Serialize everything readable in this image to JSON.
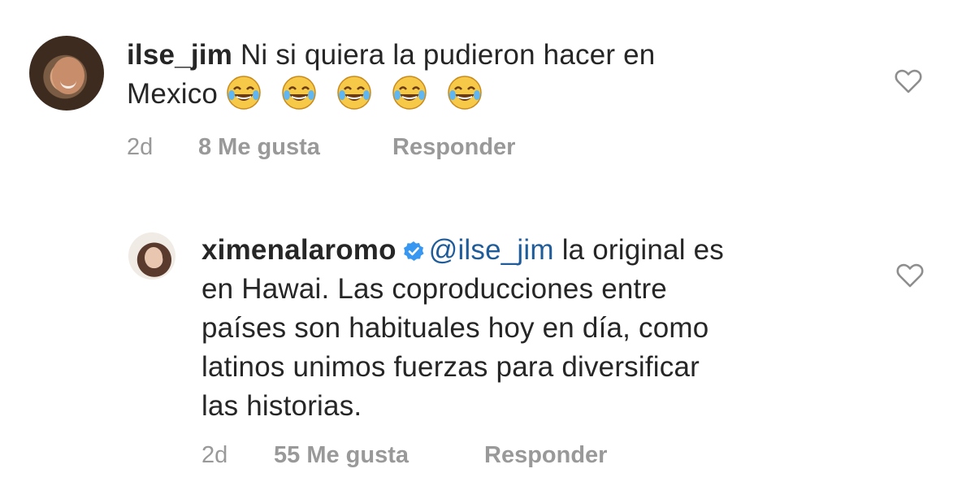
{
  "comments": [
    {
      "username": "ilse_jim",
      "text_line1": "Ni si quiera la pudieron hacer en",
      "text_line2": "Mexico",
      "emojis": [
        "face-with-tears-of-joy",
        "face-with-tears-of-joy",
        "face-with-tears-of-joy",
        "face-with-tears-of-joy",
        "face-with-tears-of-joy"
      ],
      "time": "2d",
      "likes": "8 Me gusta",
      "reply": "Responder",
      "icon": "heart-icon"
    },
    {
      "username": "ximenalaromo",
      "verified": true,
      "mention": "@ilse_jim",
      "text_line1": "la original es",
      "text_line2": "en Hawai. Las coproducciones entre",
      "text_line3": "países son habituales hoy en día, como",
      "text_line4": "latinos unimos fuerzas para diversificar",
      "text_line5": "las historias.",
      "time": "2d",
      "likes": "55 Me gusta",
      "reply": "Responder",
      "icon": "heart-icon"
    }
  ],
  "colors": {
    "text": "#262626",
    "meta": "#999999",
    "mention": "#1f5c99",
    "verified": "#3897f0",
    "emoji": "#f7c948"
  }
}
